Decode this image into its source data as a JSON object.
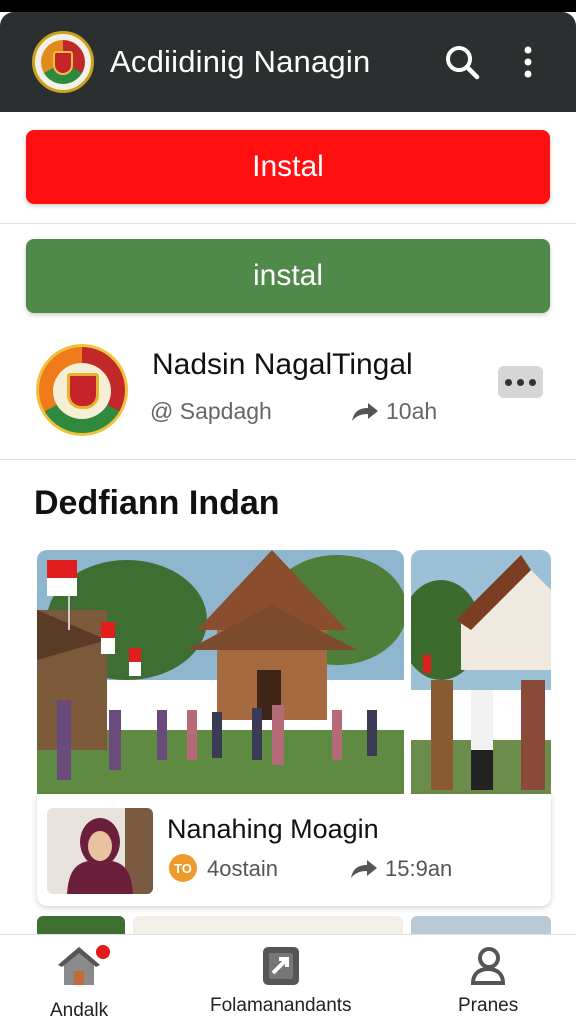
{
  "app_bar": {
    "title": "Acdiidinig Nanagin",
    "logo_icon": "emblem-logo-icon",
    "search_icon": "search-icon",
    "menu_icon": "more-vertical-icon",
    "background": "#2b2f30"
  },
  "actions": {
    "install_primary_label": "Instal",
    "install_primary_color": "#ff0f0f",
    "install_secondary_label": "instal",
    "install_secondary_color": "#4f8a4b"
  },
  "profile": {
    "name": "Nadsin NagalTingal",
    "handle": "@ Sapdagh",
    "time": "10ah",
    "share_icon": "share-arrow-icon",
    "more_icon": "more-horizontal-icon"
  },
  "section": {
    "title": "Dedfiann Indan"
  },
  "post": {
    "title": "Nanahing Moagin",
    "badge": "TO",
    "count": "4ostain",
    "time": "15:9an"
  },
  "bottom_nav": {
    "items": [
      {
        "label": "Andalk",
        "icon": "home-icon"
      },
      {
        "label": "Folamanandants",
        "icon": "open-in-app-icon"
      },
      {
        "label": "Pranes",
        "icon": "profile-icon"
      }
    ]
  }
}
